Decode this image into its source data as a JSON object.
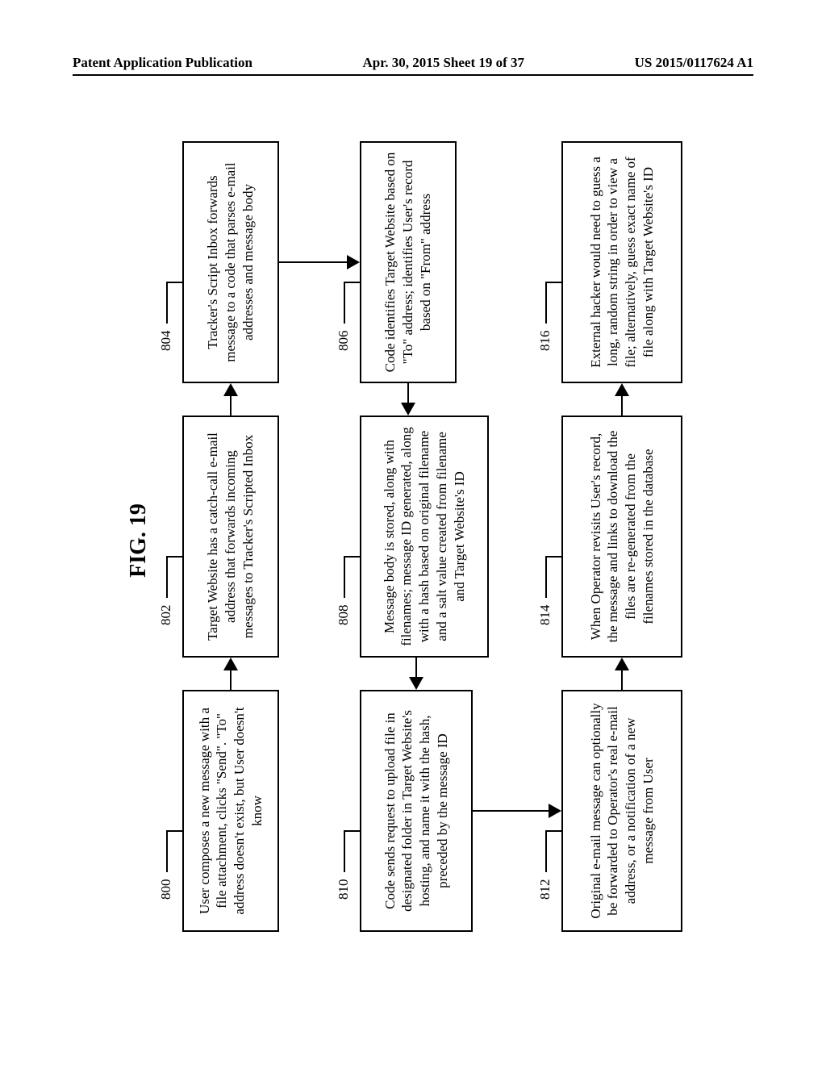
{
  "header": {
    "left": "Patent Application Publication",
    "center": "Apr. 30, 2015  Sheet 19 of 37",
    "right": "US 2015/0117624 A1"
  },
  "fig": {
    "title": "FIG. 19",
    "boxes": {
      "b800": "User composes a new message with a file attachment, clicks \"Send\". \"To\" address doesn't exist, but User doesn't know",
      "b802": "Target Website has a catch-call e-mail address that forwards incoming messages to Tracker's Scripted Inbox",
      "b804": "Tracker's Script Inbox forwards message to a code that parses e-mail addresses and message body",
      "b806": "Code identifies Target Website based on \"To\" address; identifies User's record based on \"From\" address",
      "b808": "Message body is stored, along with filenames; message ID generated, along with a hash based on original filename and a salt value created from filename and Target Website's ID",
      "b810": "Code sends request to upload file in designated folder in Target Website's hosting, and name it with the hash, preceded by the message ID",
      "b812": "Original e-mail message can optionally be forwarded to Operator's real e-mail address, or a notification of a new message from User",
      "b814": "When Operator revisits User's record, the message and links to download the files are re-generated from the filenames stored in the database",
      "b816": "External hacker would need to guess a long, random string in order to view a file; alternatively, guess exact name of file along with Target Website's ID"
    },
    "refs": {
      "r800": "800",
      "r802": "802",
      "r804": "804",
      "r806": "806",
      "r808": "808",
      "r810": "810",
      "r812": "812",
      "r814": "814",
      "r816": "816"
    }
  }
}
